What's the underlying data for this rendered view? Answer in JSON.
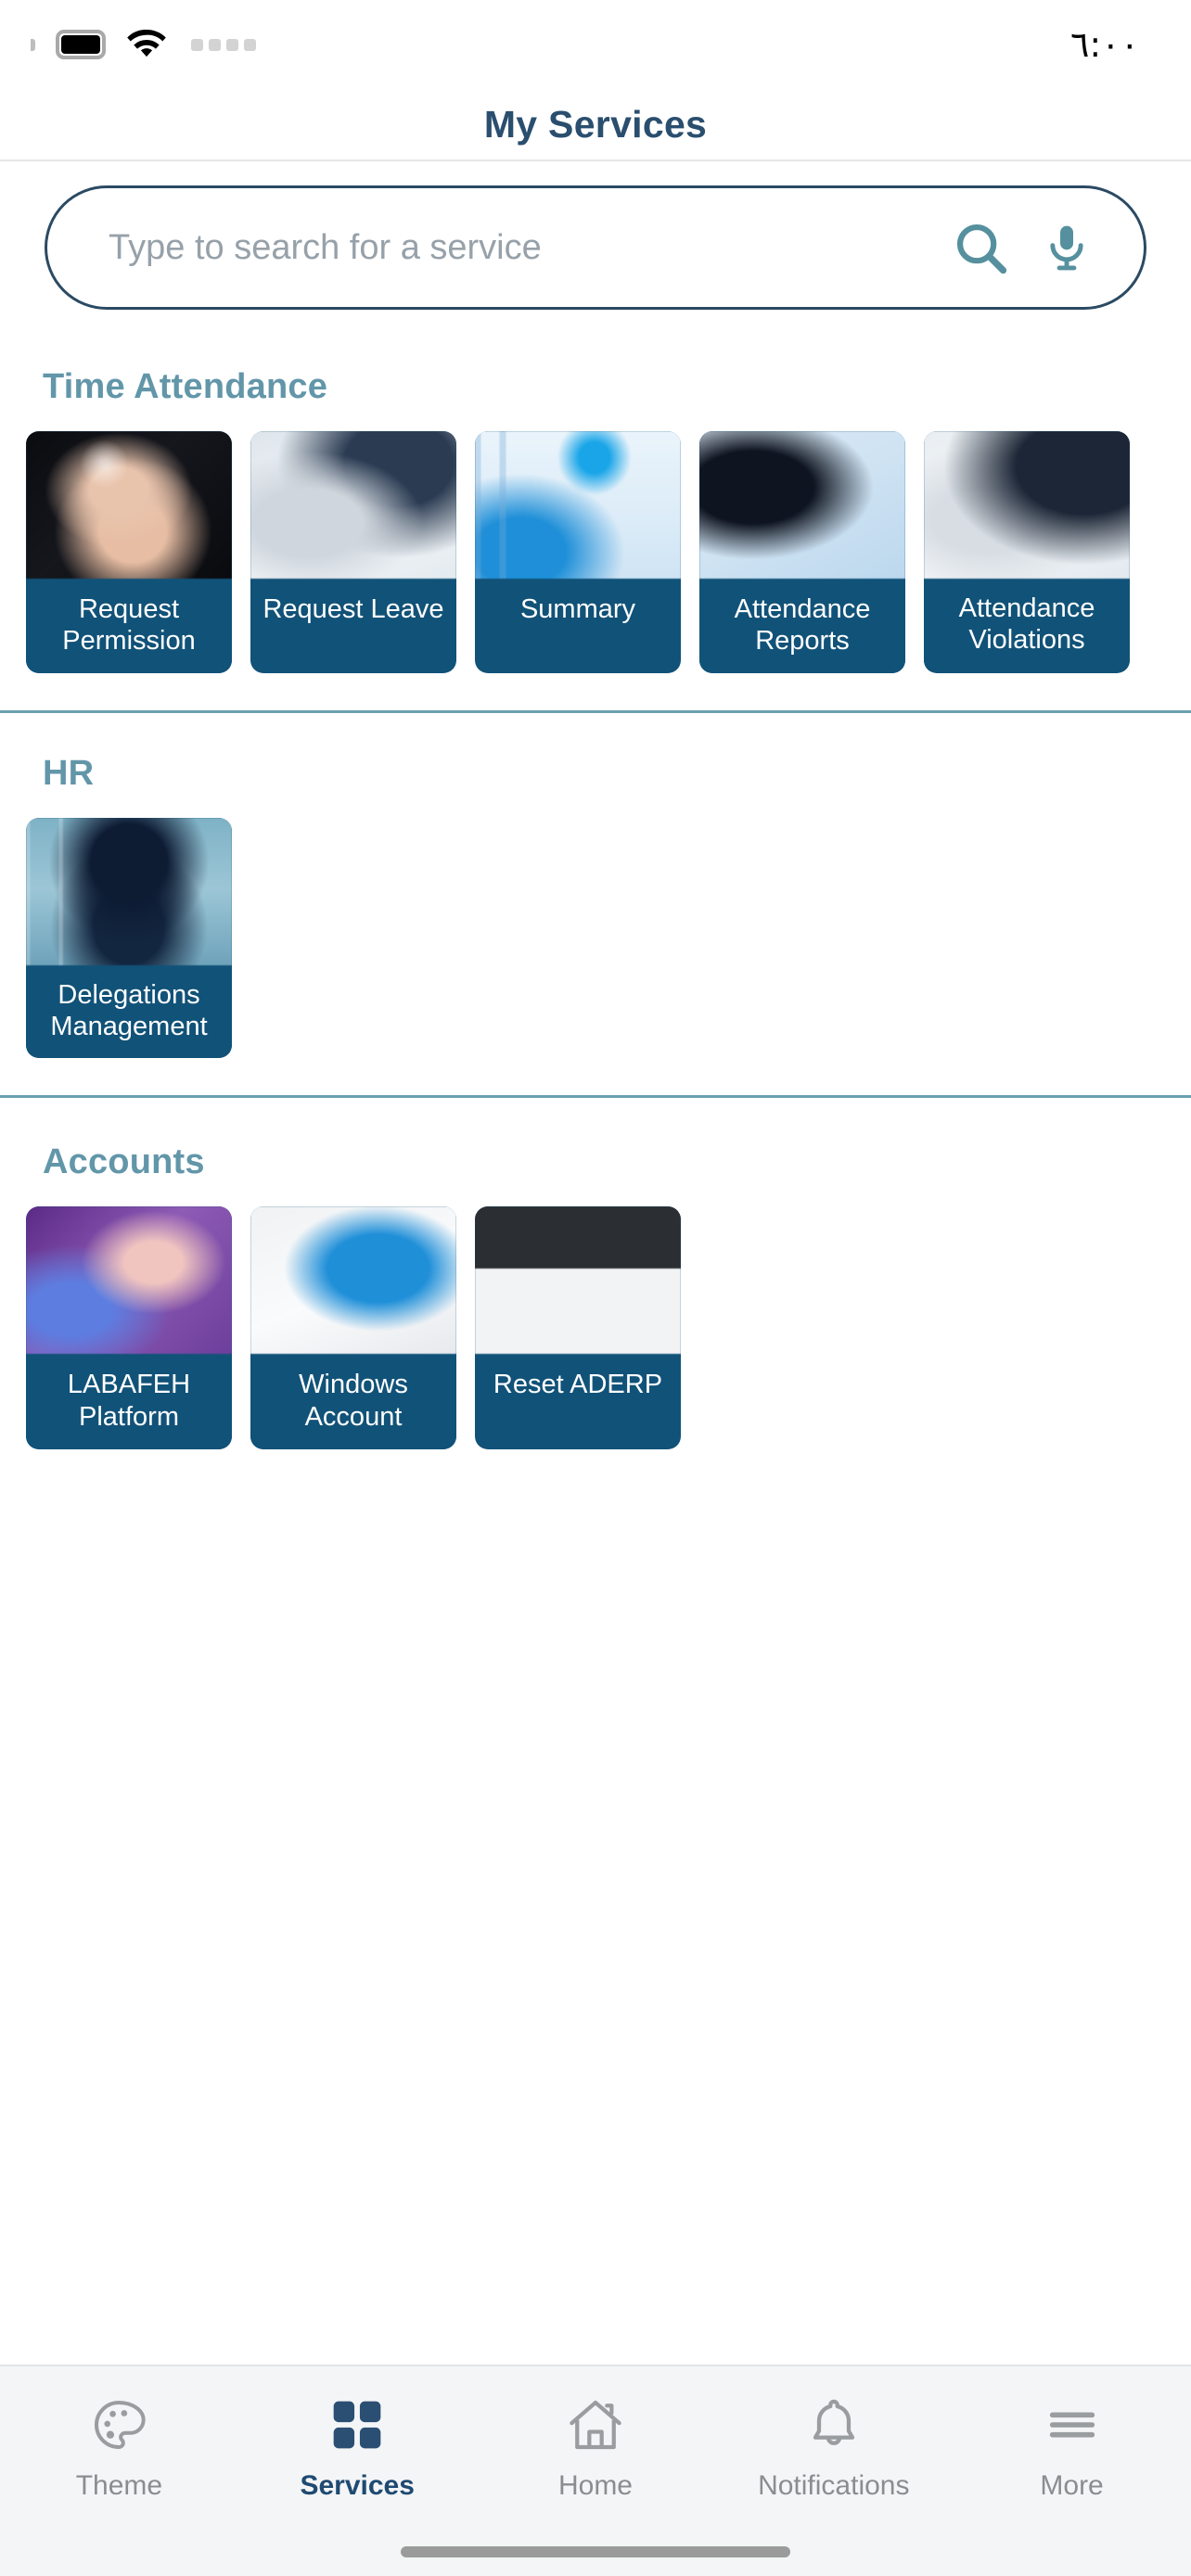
{
  "status_bar": {
    "time": "٦:٠٠",
    "battery_icon": "battery-icon",
    "wifi_icon": "wifi-icon",
    "signal_icon": "signal-dots-icon"
  },
  "header": {
    "title": "My Services"
  },
  "search": {
    "value": "",
    "placeholder": "Type to search for a service",
    "search_icon": "search-icon",
    "mic_icon": "microphone-icon"
  },
  "colors": {
    "title_navy": "#2a4e6e",
    "section_teal": "#6296a9",
    "card_label_blue": "#115278",
    "divider_teal": "#6ba0b0",
    "active_tab": "#1f4a72",
    "inactive_tab": "#8a8d90"
  },
  "sections": [
    {
      "title": "Time Attendance",
      "has_divider_above": false,
      "cards": [
        {
          "label": "Request Permission",
          "image": "img-permission",
          "two_line": false
        },
        {
          "label": "Request Leave",
          "image": "img-leave",
          "two_line": false
        },
        {
          "label": "Summary",
          "image": "img-summary",
          "two_line": false
        },
        {
          "label": "Attendance Reports",
          "image": "img-reports",
          "two_line": false
        },
        {
          "label": "Attendance Violations",
          "image": "img-violations",
          "two_line": true
        }
      ]
    },
    {
      "title": "HR",
      "has_divider_above": true,
      "cards": [
        {
          "label": "Delegations Management",
          "image": "img-delegations",
          "two_line": true
        }
      ]
    },
    {
      "title": "Accounts",
      "has_divider_above": true,
      "cards": [
        {
          "label": "LABAFEH Platform",
          "image": "img-labaeeh",
          "two_line": false
        },
        {
          "label": "Windows Account",
          "image": "img-windows",
          "two_line": false
        },
        {
          "label": "Reset ADERP",
          "image": "img-aderp",
          "two_line": false
        }
      ]
    }
  ],
  "tabbar": {
    "items": [
      {
        "label": "Theme",
        "icon": "palette-icon",
        "active": false
      },
      {
        "label": "Services",
        "icon": "grid-squares-icon",
        "active": true
      },
      {
        "label": "Home",
        "icon": "house-icon",
        "active": false
      },
      {
        "label": "Notifications",
        "icon": "bell-icon",
        "active": false
      },
      {
        "label": "More",
        "icon": "hamburger-menu-icon",
        "active": false
      }
    ]
  }
}
